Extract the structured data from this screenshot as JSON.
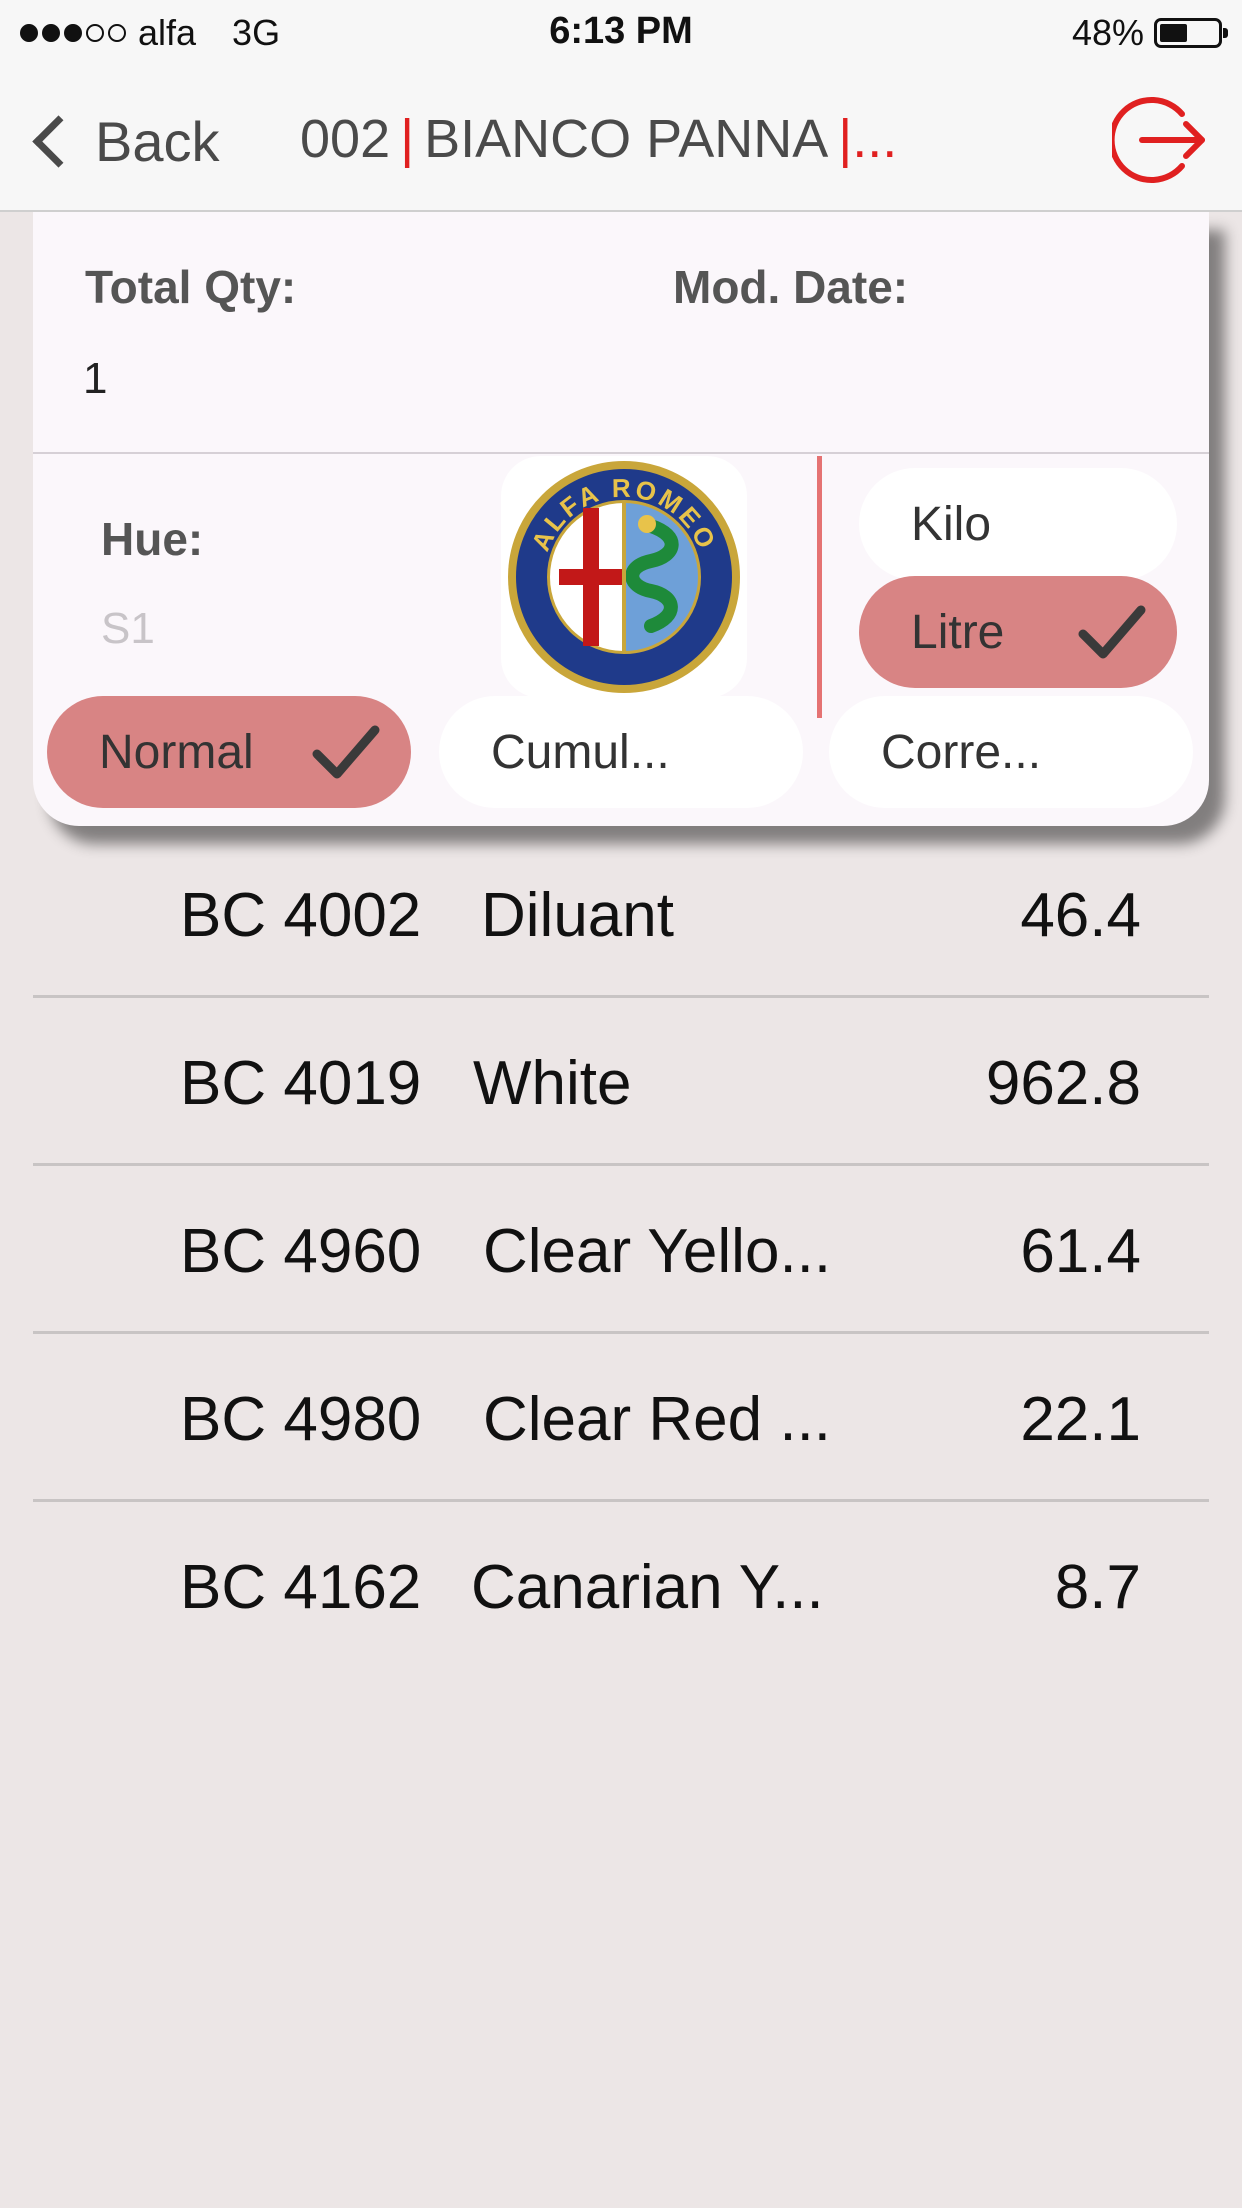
{
  "status_bar": {
    "carrier": "alfa",
    "network": "3G",
    "time": "6:13 PM",
    "battery_percent": "48%",
    "battery_level": 0.48,
    "signal_filled": 3,
    "signal_total": 5
  },
  "nav": {
    "back_label": "Back",
    "title_code": "002",
    "title_sep": "|",
    "title_name": "BIANCO PANNA",
    "title_tail": "|...",
    "exit_icon": "logout-icon"
  },
  "details": {
    "total_qty_label": "Total Qty:",
    "total_qty_value": "1",
    "mod_date_label": "Mod. Date:",
    "hue_label": "Hue:",
    "hue_value": "S1",
    "brand_logo": "ALFA ROMEO"
  },
  "units": [
    {
      "label": "Kilo",
      "selected": false
    },
    {
      "label": "Litre",
      "selected": true
    }
  ],
  "modes": [
    {
      "label": "Normal",
      "selected": true
    },
    {
      "label": "Cumul...",
      "selected": false
    },
    {
      "label": "Corre...",
      "selected": false
    }
  ],
  "colors": {
    "accent_red": "#e02020",
    "selected_pill": "#d88484",
    "background": "#ece6e6"
  },
  "formula": [
    {
      "code": "BC 4002",
      "name": "Diluant",
      "amount": "46.4"
    },
    {
      "code": "BC 4019",
      "name": "White",
      "amount": "962.8"
    },
    {
      "code": "BC 4960",
      "name": "Clear Yello...",
      "amount": "61.4"
    },
    {
      "code": "BC 4980",
      "name": "Clear Red ...",
      "amount": "22.1"
    },
    {
      "code": "BC 4162",
      "name": "Canarian Y...",
      "amount": "8.7"
    }
  ]
}
